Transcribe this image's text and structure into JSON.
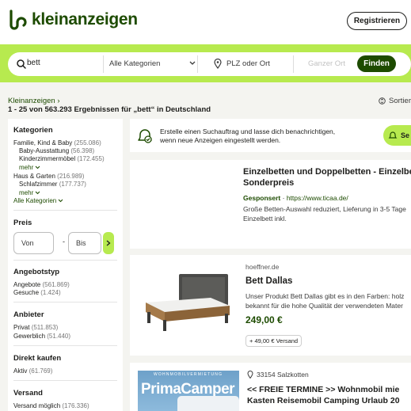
{
  "header": {
    "logo_text": "kleinanzeigen",
    "register_label": "Registrieren"
  },
  "search": {
    "query": "bett",
    "category": "Alle Kategorien",
    "location_placeholder": "PLZ oder Ort",
    "radius_placeholder": "Ganzer Ort",
    "submit_label": "Finden"
  },
  "results": {
    "breadcrumb": "Kleinanzeigen ›",
    "count_text": "1 - 25 von 563.293 Ergebnissen für „bett“ in Deutschland",
    "sort_label": "Sortieren"
  },
  "sidebar": {
    "categories_title": "Kategorien",
    "cat_family": "Familie, Kind & Baby",
    "cat_family_count": "(255.086)",
    "sub_baby": "Baby-Ausstattung",
    "sub_baby_count": "(56.398)",
    "sub_kids": "Kinderzimmermöbel",
    "sub_kids_count": "(172.455)",
    "more_label": "mehr",
    "cat_home": "Haus & Garten",
    "cat_home_count": "(216.989)",
    "sub_bedroom": "Schlafzimmer",
    "sub_bedroom_count": "(177.737)",
    "all_categories": "Alle Kategorien",
    "price_title": "Preis",
    "price_from": "Von",
    "price_dash": "-",
    "price_to": "Bis",
    "offer_title": "Angebotstyp",
    "offer_offers": "Angebote",
    "offer_offers_count": "(561.869)",
    "offer_wanted": "Gesuche",
    "offer_wanted_count": "(1.424)",
    "provider_title": "Anbieter",
    "provider_private": "Privat",
    "provider_private_count": "(511.853)",
    "provider_business": "Gewerblich",
    "provider_business_count": "(51.440)",
    "buy_title": "Direkt kaufen",
    "buy_active": "Aktiv",
    "buy_active_count": "(61.769)",
    "shipping_title": "Versand",
    "shipping_possible": "Versand möglich",
    "shipping_possible_count": "(176.336)"
  },
  "notification": {
    "line1": "Erstelle einen Suchauftrag und lasse dich benachrichtigen,",
    "line2": "wenn neue Anzeigen eingestellt werden.",
    "button_label": "Se"
  },
  "sponsored": {
    "title_line1": "Einzelbetten und Doppelbetten - Einzelbe",
    "title_line2": "Sonderpreis",
    "badge": "Gesponsert",
    "separator": " · ",
    "url": "https://www.ticaa.de/",
    "desc_line1": "Große Betten-Auswahl reduziert, Lieferung in 3-5 Tage",
    "desc_line2": "Einzelbett inkl."
  },
  "listing1": {
    "source": "hoeffner.de",
    "title": "Bett Dallas",
    "desc_line1": "Unser Produkt Bett Dallas gibt es in den Farben: holz",
    "desc_line2": "bekannt für die hohe Qualität der verwendeten Mater",
    "price": "249,00 €",
    "shipping": "+ 49,00 € Versand"
  },
  "listing2": {
    "location": "33154 Salzkotten",
    "title_line1": "<< FREIE TERMINE >> Wohnmobil mie",
    "title_line2": "Kasten Reisemobil Camping Urlaub 20",
    "image_tagline": "WOHNMOBILVERMIETUNG",
    "image_brand": "PrimaCamper"
  },
  "colors": {
    "brand_dark": "#1d4b00",
    "brand_light": "#b7ea4f",
    "background": "#f4f4f0"
  }
}
